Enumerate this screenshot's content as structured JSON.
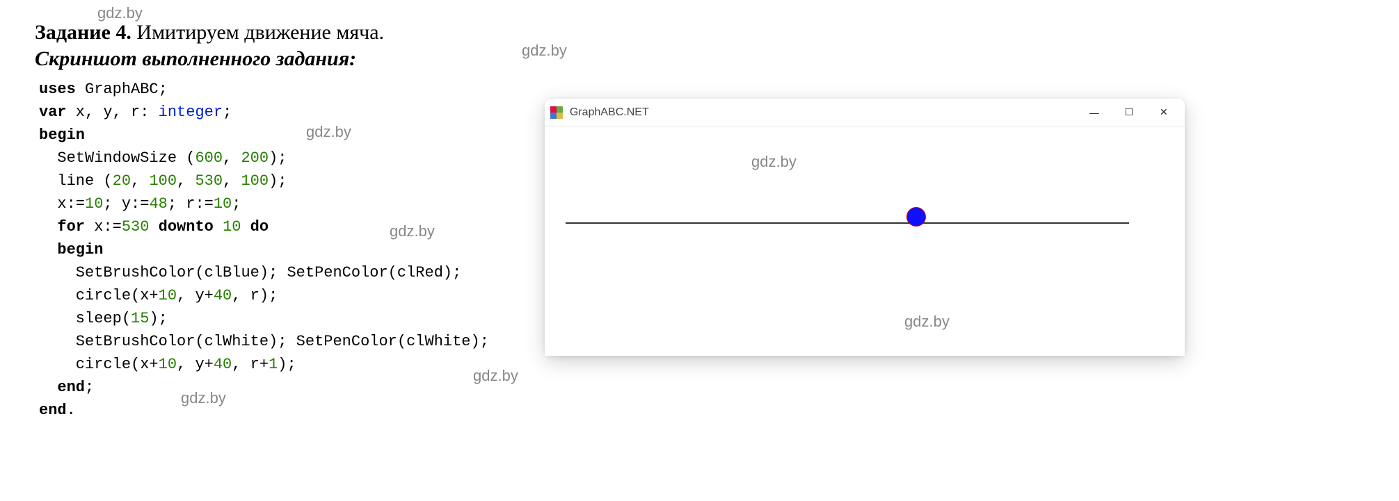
{
  "watermarks": {
    "w1": "gdz.by",
    "w2": "gdz.by",
    "w3": "gdz.by",
    "w4": "gdz.by",
    "w5": "gdz.by",
    "w6": "gdz.by",
    "w7": "gdz.by",
    "w8": "gdz.by"
  },
  "heading": {
    "label_bold": "Задание 4.",
    "label_rest": " Имитируем движение мяча."
  },
  "subheading": "Скриншот выполненного задания:",
  "code": {
    "l1_uses": "uses",
    "l1_lib": " GraphABC;",
    "l2_var": "var",
    "l2_decl": " x, y, r: ",
    "l2_type": "integer",
    "l2_semi": ";",
    "l3_begin": "begin",
    "l4_ind": "  SetWindowSize (",
    "l4_n1": "600",
    "l4_c1": ", ",
    "l4_n2": "200",
    "l4_c2": ");",
    "l5_ind": "  line (",
    "l5_n1": "20",
    "l5_c1": ", ",
    "l5_n2": "100",
    "l5_c2": ", ",
    "l5_n3": "530",
    "l5_c3": ", ",
    "l5_n4": "100",
    "l5_c4": ");",
    "l6_a": "  x:=",
    "l6_n1": "10",
    "l6_b": "; y:=",
    "l6_n2": "48",
    "l6_c": "; r:=",
    "l6_n3": "10",
    "l6_d": ";",
    "l7_a": "  ",
    "l7_for": "for",
    "l7_b": " x:=",
    "l7_n1": "530",
    "l7_c": " ",
    "l7_downto": "downto",
    "l7_d": " ",
    "l7_n2": "10",
    "l7_e": " ",
    "l7_do": "do",
    "l8_begin": "  begin",
    "l9": "    SetBrushColor(clBlue); SetPenColor(clRed);",
    "l10_a": "    circle(x+",
    "l10_n1": "10",
    "l10_b": ", y+",
    "l10_n2": "40",
    "l10_c": ", r);",
    "l11_a": "    sleep(",
    "l11_n1": "15",
    "l11_b": ");",
    "l12": "    SetBrushColor(clWhite); SetPenColor(clWhite);",
    "l13_a": "    circle(x+",
    "l13_n1": "10",
    "l13_b": ", y+",
    "l13_n2": "40",
    "l13_c": ", r+",
    "l13_n3": "1",
    "l13_d": ");",
    "l14_end": "  end",
    "l14_semi": ";",
    "l15_end": "end",
    "l15_dot": "."
  },
  "window": {
    "title": "GraphABC.NET",
    "minimize": "—",
    "maximize": "☐",
    "close": "✕"
  }
}
